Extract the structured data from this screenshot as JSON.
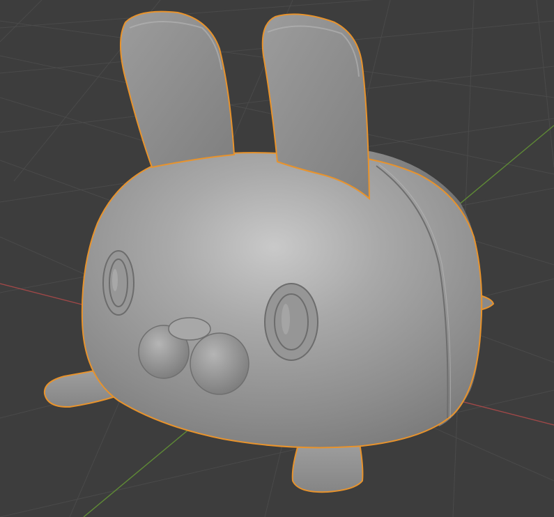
{
  "viewport": {
    "background_color": "#3d3d3d",
    "grid_line_color": "#4a4a4a",
    "x_axis_color": "#a04848",
    "y_axis_color": "#5f8a36"
  },
  "object": {
    "name_semantic": "bunny-loaf-mesh",
    "selected": true,
    "selection_outline_color": "#e8932c",
    "material_color": "#8e8e8e",
    "shading": "solid"
  }
}
